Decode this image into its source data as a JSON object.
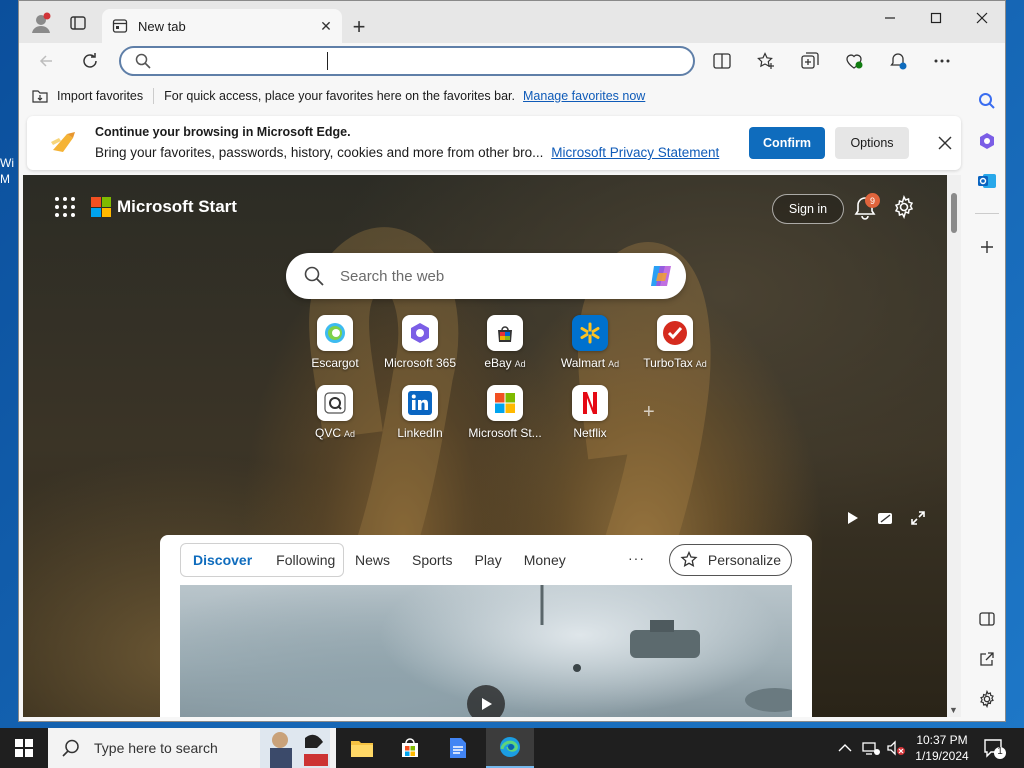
{
  "browser": {
    "tab": {
      "title": "New tab"
    },
    "address_bar": {
      "value": "",
      "placeholder": ""
    },
    "favorites_bar": {
      "import_label": "Import favorites",
      "hint": "For quick access, place your favorites here on the favorites bar.",
      "manage_link": "Manage favorites now"
    },
    "banner": {
      "title": "Continue your browsing in Microsoft Edge.",
      "body": "Bring your favorites, passwords, history, cookies and more from other bro...",
      "link": "Microsoft Privacy Statement",
      "confirm": "Confirm",
      "options": "Options"
    }
  },
  "start_page": {
    "brand": "Microsoft Start",
    "sign_in": "Sign in",
    "notification_count": "9",
    "search_placeholder": "Search the web",
    "tiles": [
      {
        "label": "Escargot",
        "ad": "",
        "icon": "escargot-icon"
      },
      {
        "label": "Microsoft 365",
        "ad": "",
        "icon": "microsoft-365-icon"
      },
      {
        "label": "eBay",
        "ad": "Ad",
        "icon": "ebay-icon"
      },
      {
        "label": "Walmart",
        "ad": "Ad",
        "icon": "walmart-icon"
      },
      {
        "label": "TurboTax",
        "ad": "Ad",
        "icon": "turbotax-icon"
      },
      {
        "label": "QVC",
        "ad": "Ad",
        "icon": "qvc-icon"
      },
      {
        "label": "LinkedIn",
        "ad": "",
        "icon": "linkedin-icon"
      },
      {
        "label": "Microsoft St...",
        "ad": "",
        "icon": "microsoft-store-icon"
      },
      {
        "label": "Netflix",
        "ad": "",
        "icon": "netflix-icon"
      }
    ],
    "feed": {
      "tabs": [
        "Discover",
        "Following"
      ],
      "active_tab": "Discover",
      "categories": [
        "News",
        "Sports",
        "Play",
        "Money"
      ],
      "more": "···",
      "personalize": "Personalize"
    }
  },
  "taskbar": {
    "search_placeholder": "Type here to search",
    "time": "10:37 PM",
    "date": "1/19/2024",
    "notification_count": "1"
  },
  "colors": {
    "accent": "#0f6cbd",
    "link": "#0f5bb8",
    "taskbar": "#1f1f1f"
  }
}
